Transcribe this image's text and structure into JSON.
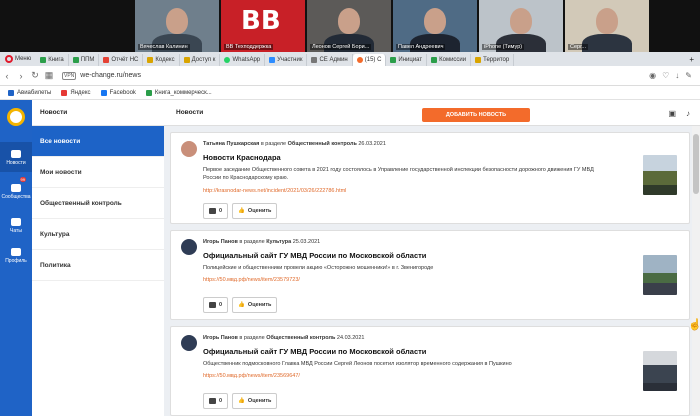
{
  "video_tiles": [
    {
      "name": "Вячеслав Калинин",
      "bg": "#6f7f8c",
      "body": "#3a4652"
    },
    {
      "name": "ВВ Техподдержка",
      "bg": "#c82027",
      "body": "#c82027",
      "logo": "ВВ"
    },
    {
      "name": "Леонов Сергей Бори...",
      "bg": "#5c5a58",
      "body": "#222a36"
    },
    {
      "name": "Павел Андреевич",
      "bg": "#4f6b85",
      "body": "#1d2430"
    },
    {
      "name": "iPhone (Тимур)",
      "bg": "#bcc3c9",
      "body": "#2b2f38"
    },
    {
      "name": "Серг...",
      "bg": "#d2c9b8",
      "body": "#2c3440"
    }
  ],
  "browser": {
    "menu_label": "Меню",
    "tabs": [
      {
        "label": "Книга",
        "color": "#2b9e4a"
      },
      {
        "label": "ППМ",
        "color": "#2b9e4a"
      },
      {
        "label": "Отчёт НС",
        "color": "#e44134"
      },
      {
        "label": "Кодекс",
        "color": "#d9a400"
      },
      {
        "label": "Доступ к",
        "color": "#d9a400"
      },
      {
        "label": "WhatsApp",
        "color": "#25d366"
      },
      {
        "label": "Участник",
        "color": "#2d8cff"
      },
      {
        "label": "СЕ Админ",
        "color": "#777"
      },
      {
        "label": "(15) С",
        "color": "#f36b2b",
        "active": true
      },
      {
        "label": "Инициат",
        "color": "#2b9e4a"
      },
      {
        "label": "Комиссии",
        "color": "#2b9e4a"
      },
      {
        "label": "Территор",
        "color": "#d9a400"
      }
    ],
    "plus": "+",
    "vpn": "VPN",
    "url": "we-change.ru/news",
    "bookmarks": [
      {
        "label": "Авиабилеты",
        "color": "#1f63c6"
      },
      {
        "label": "Яндекс",
        "color": "#e53935"
      },
      {
        "label": "Facebook",
        "color": "#1877f2"
      },
      {
        "label": "Книга_коммерческ...",
        "color": "#2b9e4a"
      }
    ]
  },
  "rail": {
    "items": [
      {
        "label": "Новости"
      },
      {
        "label": "Сообщества",
        "badge": "99"
      },
      {
        "label": "Чаты"
      },
      {
        "label": "Профиль"
      }
    ]
  },
  "sidemenu": {
    "header": "Новости",
    "items": [
      "Все новости",
      "Мои новости",
      "Общественный контроль",
      "Культура",
      "Политика"
    ]
  },
  "content": {
    "header": "Новости",
    "add_button": "ДОБАВИТЬ НОВОСТЬ"
  },
  "posts": [
    {
      "author": "Татьяна Пушкарская",
      "in_section": "в разделе",
      "section": "Общественный контроль",
      "date": "26.03.2021",
      "title": "Новости Краснодара",
      "desc": "Первое заседание Общественного совета в 2021 году состоялось в Управление государственной инспекции безопасности дорожного движения ГУ МВД России по Краснодарскому краю.",
      "link": "http://krasnodar-news.net/incident/2021/03/26/222786.html",
      "comments": "0",
      "rate": "Оценить",
      "avatar_color": "#c98f7a",
      "thumb": [
        "#c7d3de",
        "#5b6a3a",
        "#2f3a2a"
      ]
    },
    {
      "author": "Игорь Панов",
      "in_section": "в разделе",
      "section": "Культура",
      "date": "25.03.2021",
      "title": "Официальный сайт ГУ МВД России по Московской области",
      "desc": "Полицейские и общественники провели акцию «Осторожно мошенники!» в г. Звенигороде",
      "link": "https://50.мвд.рф/news/item/23579723/",
      "comments": "0",
      "rate": "Оценить",
      "avatar_color": "#2f3c55",
      "thumb": [
        "#9fb3c4",
        "#4a6b43",
        "#3a3f4a"
      ]
    },
    {
      "author": "Игорь Панов",
      "in_section": "в разделе",
      "section": "Общественный контроль",
      "date": "24.03.2021",
      "title": "Официальный сайт ГУ МВД России по Московской области",
      "desc": "Общественник подмосковного Главка МВД России Сергей Леонов посетил изолятор временного содержания в Пушкино",
      "link": "https://50.мвд.рф/news/item/23569647/",
      "comments": "0",
      "rate": "Оценить",
      "avatar_color": "#2f3c55",
      "thumb": [
        "#d5d8dc",
        "#3b4450",
        "#2a2f38"
      ]
    }
  ]
}
